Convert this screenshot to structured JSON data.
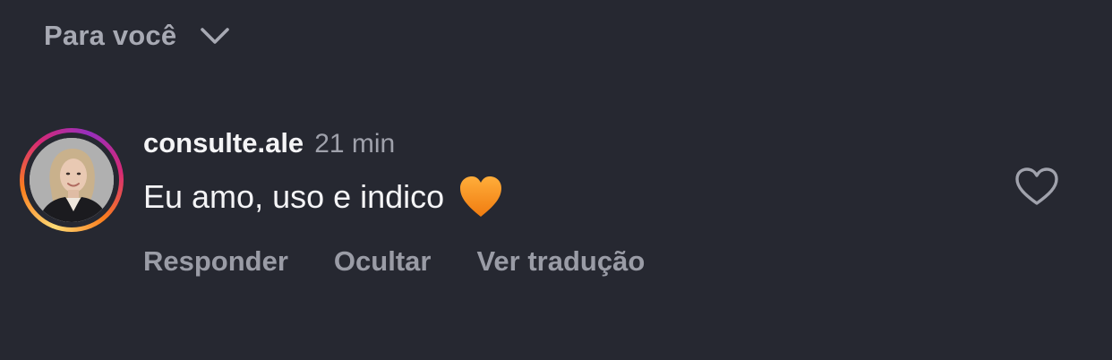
{
  "filter": {
    "label": "Para você",
    "icon": "chevron-down-icon"
  },
  "comment": {
    "username": "consulte.ale",
    "timestamp": "21 min",
    "text": "Eu amo, uso e indico",
    "emoji": "orange-heart-icon",
    "like_icon": "heart-outline-icon",
    "actions": {
      "reply": "Responder",
      "hide": "Ocultar",
      "translate": "Ver tradução"
    }
  },
  "colors": {
    "background": "#262831",
    "primary_text": "#f4f4f6",
    "secondary_text": "#9a9ca6",
    "emoji_heart": "#f7931e"
  }
}
